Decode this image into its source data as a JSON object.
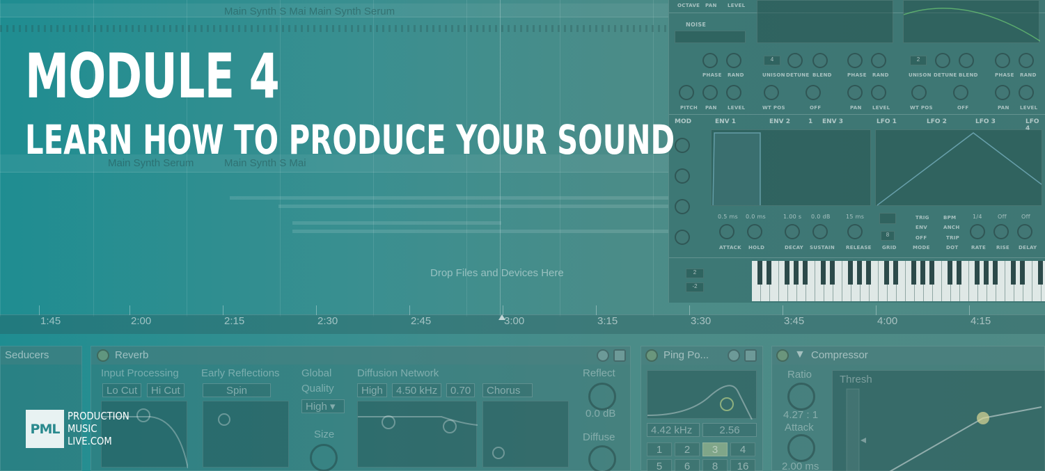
{
  "overlay": {
    "headline": "MODULE 4",
    "subline": "LEARN HOW TO PRODUCE YOUR SOUND"
  },
  "logo": {
    "mark": "PML",
    "line1": "PRODUCTION",
    "line2": "MUSIC",
    "line3": "LIVE.COM"
  },
  "arrangement": {
    "clip_top": "Main Synth S Mai Main Synth Serum",
    "clip_mid_a": "Main Synth Serum",
    "clip_mid_b": "Main Synth S Mai",
    "drop_hint": "Drop Files and Devices Here",
    "timeline": [
      "1:45",
      "2:00",
      "2:15",
      "2:30",
      "2:45",
      "3:00",
      "3:15",
      "3:30",
      "3:45",
      "4:00",
      "4:15"
    ]
  },
  "serum": {
    "noise_label": "NOISE",
    "top_labels": [
      "OCTAVE",
      "PAN",
      "LEVEL"
    ],
    "osc_row1": [
      "PHASE",
      "RAND",
      "UNISON",
      "DETUNE",
      "BLEND",
      "PHASE",
      "RAND",
      "UNISON",
      "DETUNE",
      "BLEND",
      "PHASE",
      "RAND"
    ],
    "osc_row2": [
      "PITCH",
      "PAN",
      "LEVEL",
      "WT POS",
      "OFF",
      "PAN",
      "LEVEL",
      "WT POS",
      "OFF",
      "PAN",
      "LEVEL"
    ],
    "unison_a": "4",
    "unison_b": "2",
    "mod_tabs": [
      "MOD",
      "ENV 1",
      "ENV 2",
      "1",
      "ENV 3",
      "LFO 1",
      "LFO 2",
      "LFO 3",
      "LFO 4"
    ],
    "env_values": [
      "0.5 ms",
      "0.0 ms",
      "1.00 s",
      "0.0 dB",
      "15 ms"
    ],
    "env_labels": [
      "ATTACK",
      "HOLD",
      "DECAY",
      "SUSTAIN",
      "RELEASE"
    ],
    "lfo_values": [
      "1/4",
      "Off",
      "Off"
    ],
    "lfo_labels": [
      "GRID",
      "MODE",
      "RATE",
      "RISE",
      "DELAY"
    ],
    "lfo_options": [
      "TRIG",
      "BPM",
      "ENV",
      "ANCH",
      "OFF",
      "TRIP",
      "DOT"
    ],
    "grid_value": "8",
    "pitch_up": "2",
    "pitch_down": "-2"
  },
  "devices": {
    "reverb": {
      "title": "Reverb",
      "section_input": "Input Processing",
      "section_early": "Early Reflections",
      "section_global": "Global",
      "section_diffusion": "Diffusion Network",
      "lo_cut": "Lo Cut",
      "hi_cut": "Hi Cut",
      "spin": "Spin",
      "quality_label": "Quality",
      "quality_value": "High",
      "size_label": "Size",
      "diff_high": "High",
      "diff_freq": "4.50 kHz",
      "diff_amt": "0.70",
      "chorus": "Chorus",
      "reflect_label": "Reflect",
      "reflect_value": "0.0 dB",
      "diffuse_label": "Diffuse"
    },
    "left_stub": "Seducers",
    "pingpong": {
      "title": "Ping Po...",
      "freq": "4.42 kHz",
      "width": "2.56",
      "keys": [
        "1",
        "2",
        "3",
        "4",
        "5",
        "6",
        "8",
        "16"
      ]
    },
    "compressor": {
      "title": "Compressor",
      "ratio_label": "Ratio",
      "ratio_value": "4.27 : 1",
      "attack_label": "Attack",
      "attack_value": "2.00 ms",
      "thresh_label": "Thresh"
    }
  }
}
